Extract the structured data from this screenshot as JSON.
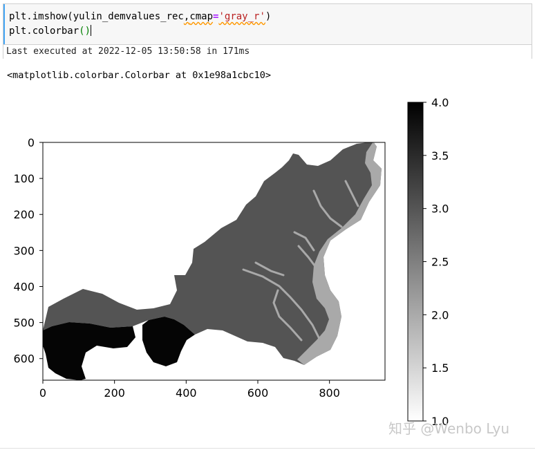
{
  "notebook": {
    "code_lines": {
      "line1_prefix": "plt.imshow(yulin_demvalues_rec",
      "line1_comma": ",",
      "line1_kw": "cmap",
      "line1_eq": "=",
      "line1_str": "'gray_r'",
      "line1_close": ")",
      "line2_prefix": "plt.colorbar",
      "line2_parens": "()"
    },
    "exec_status": "Last executed at 2022-12-05 13:50:58 in 171ms",
    "output_repr": "<matplotlib.colorbar.Colorbar at 0x1e98a1cbc10>"
  },
  "chart_data": {
    "type": "heatmap",
    "title": "",
    "colormap": "gray_r",
    "image_axes": {
      "xticks": [
        "0",
        "200",
        "400",
        "600",
        "800"
      ],
      "yticks": [
        "0",
        "100",
        "200",
        "300",
        "400",
        "500",
        "600"
      ],
      "xlim": [
        0,
        955
      ],
      "ylim": [
        660,
        0
      ]
    },
    "colorbar": {
      "range": [
        1.0,
        4.0
      ],
      "ticks": [
        "1.0",
        "1.5",
        "2.0",
        "2.5",
        "3.0",
        "3.5",
        "4.0"
      ]
    },
    "value_regions": [
      {
        "value": 3.0,
        "region": "main plateau"
      },
      {
        "value": 4.0,
        "region": "southwest block"
      },
      {
        "value": 2.0,
        "region": "eastern valleys"
      }
    ]
  },
  "watermark": "知乎 @Wenbo Lyu",
  "colors": {
    "cell_border": "#cfcfcf",
    "active_cell_bar": "#42a5f5",
    "string": "#ba2121"
  }
}
